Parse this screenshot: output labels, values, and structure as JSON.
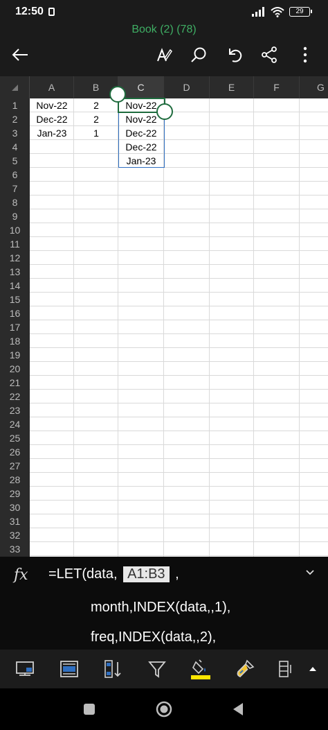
{
  "status_bar": {
    "time": "12:50",
    "battery": "29",
    "icons": [
      "lock-icon",
      "signal-icon",
      "wifi-icon",
      "battery-icon"
    ]
  },
  "title_bar": {
    "title": "Book (2) (78)",
    "title_color": "#3fae64",
    "icons": [
      "back-arrow-icon",
      "draw-pen-icon",
      "search-icon",
      "undo-icon",
      "share-icon",
      "more-vertical-icon"
    ]
  },
  "sheet": {
    "columns": [
      "A",
      "B",
      "C",
      "D",
      "E",
      "F",
      "G"
    ],
    "selected_column": "C",
    "rows": [
      "1",
      "2",
      "3",
      "4",
      "5",
      "6",
      "7",
      "8",
      "9",
      "10",
      "11",
      "12",
      "13",
      "14",
      "15",
      "16",
      "17",
      "18",
      "19",
      "20",
      "21",
      "22",
      "23",
      "24",
      "25",
      "26",
      "27",
      "28",
      "29",
      "30",
      "31",
      "32",
      "33"
    ],
    "data": {
      "A": [
        "Nov-22",
        "Dec-22",
        "Jan-23"
      ],
      "B": [
        "2",
        "2",
        "1"
      ],
      "C": [
        "Nov-22",
        "Nov-22",
        "Dec-22",
        "Dec-22",
        "Jan-23"
      ]
    },
    "selection_color": "#1e6b3d",
    "spill_color": "#2f6fc1"
  },
  "formula_bar": {
    "fx_label": "fx",
    "line1_prefix": "=LET(data, ",
    "line1_ref": "A1:B3",
    "line1_suffix": " ,",
    "line2": "month,INDEX(data,,1),",
    "line3": "freq,INDEX(data,,2),"
  },
  "bottom_toolbar": {
    "icons": [
      "view-icon",
      "layout-icon",
      "sort-icon",
      "filter-icon",
      "fill-color-icon",
      "format-painter-icon",
      "insert-column-icon",
      "expand-up-icon"
    ],
    "fill_accent": "#ffe600"
  },
  "nav_bar": {
    "icons": [
      "recents-square-icon",
      "home-circle-icon",
      "back-triangle-icon"
    ]
  }
}
